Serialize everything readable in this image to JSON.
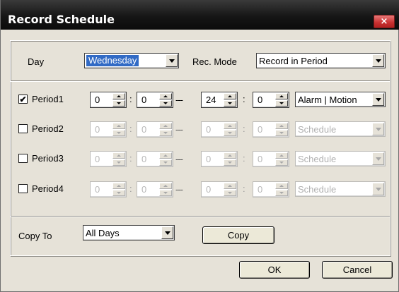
{
  "window": {
    "title": "Record Schedule",
    "close_label": "×"
  },
  "header_row": {
    "day_label": "Day",
    "day_value": "Wednesday",
    "rec_mode_label": "Rec. Mode",
    "rec_mode_value": "Record in Period"
  },
  "periods": [
    {
      "label": "Period1",
      "checked": true,
      "enabled": true,
      "start_hour": "0",
      "start_min": "0",
      "end_hour": "24",
      "end_min": "0",
      "type": "Alarm | Motion",
      "check_mark": "✔"
    },
    {
      "label": "Period2",
      "checked": false,
      "enabled": false,
      "start_hour": "0",
      "start_min": "0",
      "end_hour": "0",
      "end_min": "0",
      "type": "Schedule",
      "check_mark": ""
    },
    {
      "label": "Period3",
      "checked": false,
      "enabled": false,
      "start_hour": "0",
      "start_min": "0",
      "end_hour": "0",
      "end_min": "0",
      "type": "Schedule",
      "check_mark": ""
    },
    {
      "label": "Period4",
      "checked": false,
      "enabled": false,
      "start_hour": "0",
      "start_min": "0",
      "end_hour": "0",
      "end_min": "0",
      "type": "Schedule",
      "check_mark": ""
    }
  ],
  "separators": {
    "colon": ":",
    "dash": "---"
  },
  "copy_row": {
    "copy_to_label": "Copy To",
    "copy_to_value": "All Days",
    "copy_button": "Copy"
  },
  "footer": {
    "ok_label": "OK",
    "cancel_label": "Cancel"
  },
  "icons": {
    "close": "close-icon",
    "dropdown": "chevron-down-icon",
    "spin_up": "spin-up-icon",
    "spin_down": "spin-down-icon",
    "check": "check-icon"
  },
  "colors": {
    "title_bar": "#161616",
    "close_button": "#c83030",
    "selection": "#316ac5",
    "dialog_bg": "#e6e2d8"
  }
}
